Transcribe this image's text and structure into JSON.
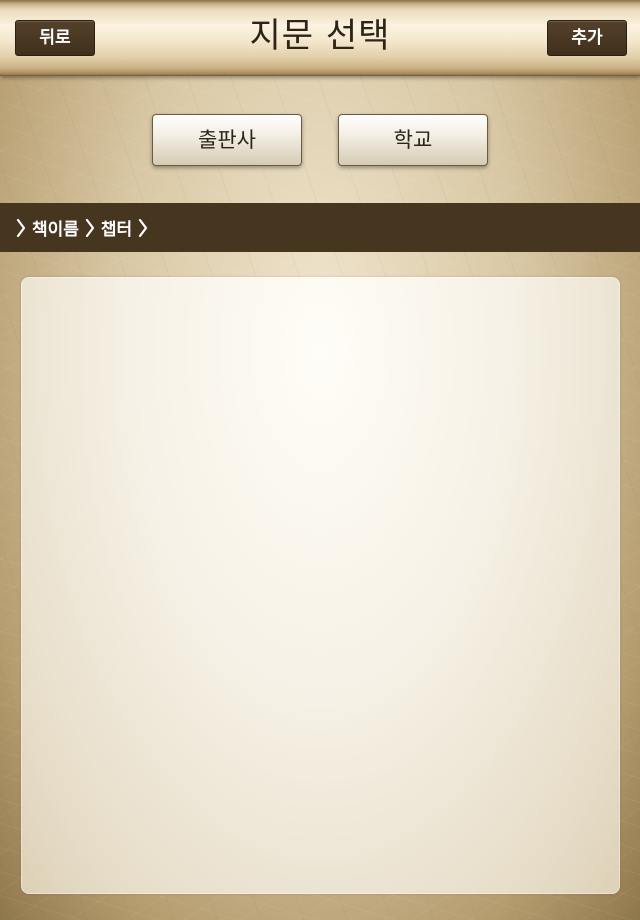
{
  "navbar": {
    "title": "지문 선택",
    "back_label": "뒤로",
    "add_label": "추가"
  },
  "categories": {
    "publisher_label": "출판사",
    "school_label": "학교"
  },
  "breadcrumb": {
    "items": [
      "책이름",
      "챕터"
    ]
  },
  "colors": {
    "nav_button": "#47361f",
    "breadcrumb_bar": "#47361f",
    "title_text": "#2d2418"
  }
}
